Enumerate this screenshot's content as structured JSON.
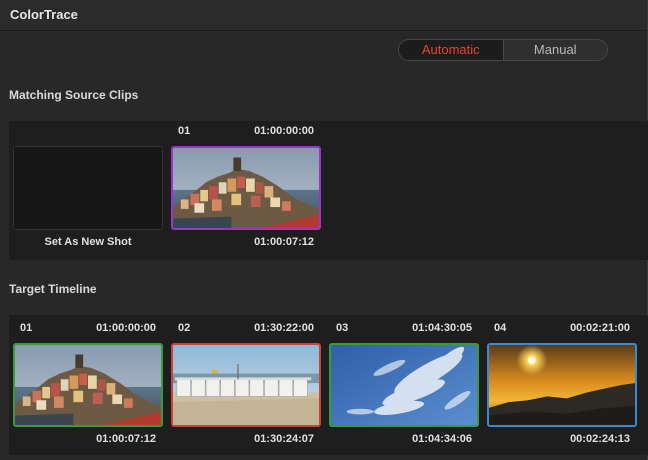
{
  "window": {
    "title": "ColorTrace"
  },
  "mode_toggle": {
    "options": [
      "Automatic",
      "Manual"
    ],
    "selected": "Automatic"
  },
  "colors": {
    "active_toggle": "#e5452f",
    "purple_border": "#9a35c9",
    "green_border": "#3c9a3c",
    "red_border": "#c8443a",
    "blue_border": "#3e88cf"
  },
  "source": {
    "label": "Matching Source Clips",
    "set_new_shot_label": "Set As New Shot",
    "clips": [
      {
        "number": "01",
        "start_tc": "01:00:00:00",
        "end_tc": "01:00:07:12",
        "image": "coastal-village",
        "border": "purple"
      }
    ]
  },
  "target": {
    "label": "Target Timeline",
    "clips": [
      {
        "number": "01",
        "start_tc": "01:00:00:00",
        "end_tc": "01:00:07:12",
        "image": "coastal-village",
        "border": "green"
      },
      {
        "number": "02",
        "start_tc": "01:30:22:00",
        "end_tc": "01:30:24:07",
        "image": "beach-huts",
        "border": "red"
      },
      {
        "number": "03",
        "start_tc": "01:04:30:05",
        "end_tc": "01:04:34:06",
        "image": "cloudy-sky",
        "border": "green"
      },
      {
        "number": "04",
        "start_tc": "00:02:21:00",
        "end_tc": "00:02:24:13",
        "image": "sunset",
        "border": "blue"
      }
    ]
  }
}
